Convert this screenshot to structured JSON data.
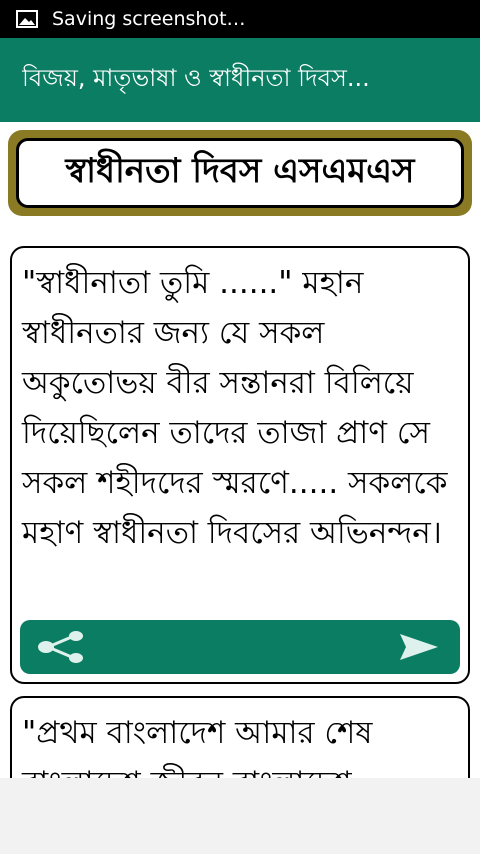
{
  "status_bar": {
    "notification_text": "Saving screenshot…",
    "icon": "image-icon"
  },
  "app_bar": {
    "title": "বিজয়, মাতৃভাষা ও স্বাধীনতা দিবস..."
  },
  "header": {
    "title": "স্বাধীনতা দিবস এসএমএস"
  },
  "messages": [
    {
      "text": "\"স্বাধীনাতা তুমি ......\" মহান স্বাধীনতার জন্য যে সকল অকুতোভয় বীর সন্তানরা বিলিয়ে দিয়েছিলেন তাদের তাজা প্রাণ সে সকল শহীদদের স্মরণে..... সকলকে মহাণ স্বাধীনতা দিবসের অভিনন্দন।"
    },
    {
      "text": "\"প্রথম বাংলাদেশ আমার শেষ বাংলাদেশ জীবন বাংলাদেশ"
    }
  ],
  "actions": {
    "share_icon": "share-icon",
    "send_icon": "send-icon"
  },
  "colors": {
    "primary": "#0b7d63",
    "header_frame": "#8a7a24",
    "status_bar": "#000000"
  }
}
